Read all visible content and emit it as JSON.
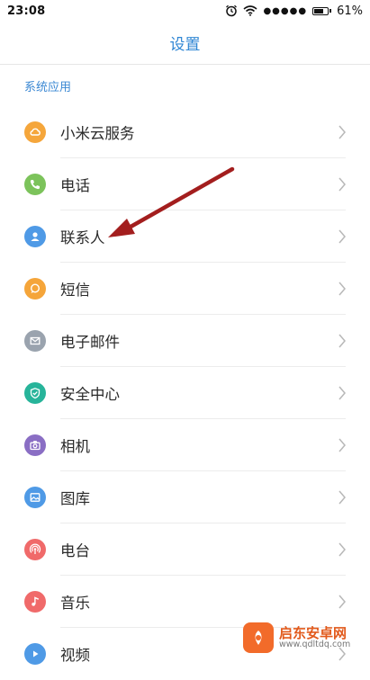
{
  "status_bar": {
    "time": "23:08",
    "signal": "●●●●●",
    "battery_text": "61%",
    "battery_level": 0.61
  },
  "header": {
    "title": "设置"
  },
  "section": {
    "title": "系统应用"
  },
  "items": [
    {
      "label": "小米云服务",
      "icon": "cloud-icon",
      "color": "#f5a63b"
    },
    {
      "label": "电话",
      "icon": "phone-icon",
      "color": "#7cc35b"
    },
    {
      "label": "联系人",
      "icon": "person-icon",
      "color": "#4f9ae6"
    },
    {
      "label": "短信",
      "icon": "message-icon",
      "color": "#f5a53a"
    },
    {
      "label": "电子邮件",
      "icon": "mail-icon",
      "color": "#9aa3ae"
    },
    {
      "label": "安全中心",
      "icon": "shield-icon",
      "color": "#27b49a"
    },
    {
      "label": "相机",
      "icon": "camera-icon",
      "color": "#8a6ec4"
    },
    {
      "label": "图库",
      "icon": "gallery-icon",
      "color": "#4f9ae6"
    },
    {
      "label": "电台",
      "icon": "radio-icon",
      "color": "#f06a6a"
    },
    {
      "label": "音乐",
      "icon": "music-icon",
      "color": "#f06a6a"
    },
    {
      "label": "视频",
      "icon": "video-icon",
      "color": "#4f9ae6"
    }
  ],
  "watermark": {
    "title": "启东安卓网",
    "url": "www.qdltdq.com"
  },
  "colors": {
    "accent": "#2f86d4",
    "arrow": "#a31e1e"
  }
}
